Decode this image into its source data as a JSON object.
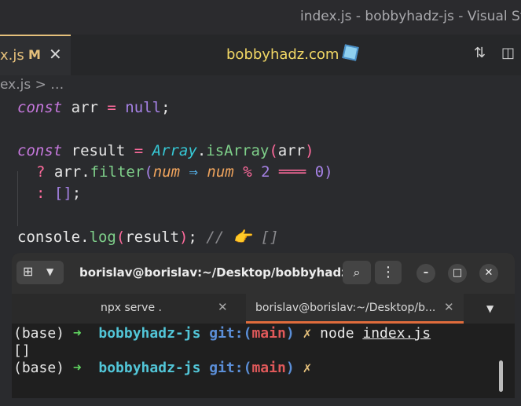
{
  "window": {
    "title": "index.js - bobbyhadz-js - Visual Stu"
  },
  "editor_tab": {
    "filename": "x.js",
    "modified_badge": "M",
    "close_glyph": "✕"
  },
  "center_title": "bobbyhadz.com",
  "breadcrumb": "ex.js > …",
  "code": {
    "line1": {
      "kw": "const",
      "name": " arr ",
      "op": "=",
      "val": " null",
      "semi": ";"
    },
    "line3": {
      "kw": "const",
      "name": " result ",
      "op": "=",
      "cls": " Array",
      "dot": ".",
      "fn": "isArray",
      "p1": "(",
      "arg": "arr",
      "p2": ")"
    },
    "line4": {
      "q": "? ",
      "obj": "arr",
      "dot": ".",
      "fn": "filter",
      "p1": "(",
      "param": "num",
      "arrow": " ⇒ ",
      "param2": "num",
      "mod": " % ",
      "two": "2",
      "eq": " ═══ ",
      "zero": "0",
      "p2": ")"
    },
    "line5": {
      "colon": ": ",
      "arr": "[]",
      "semi": ";"
    },
    "line7": {
      "obj": "console",
      "dot": ".",
      "fn": "log",
      "p1": "(",
      "arg": "result",
      "p2": ")",
      "semi": ";",
      "comment": " // 👉 []"
    }
  },
  "terminal": {
    "title": "borislav@borislav:~/Desktop/bobbyhadz-r...",
    "tabs": [
      {
        "label": "npx serve ."
      },
      {
        "label": "borislav@borislav:~/Desktop/b..."
      }
    ],
    "lines": [
      {
        "base": "(base) ",
        "arrow": "➜",
        "dir": "  bobbyhadz-js",
        "git": " git:(",
        "branch": "main",
        "gitclose": ")",
        "x": " ✗",
        "cmd": " node ",
        "file": "index.js"
      },
      {
        "output": "[]"
      },
      {
        "base": "(base) ",
        "arrow": "➜",
        "dir": "  bobbyhadz-js",
        "git": " git:(",
        "branch": "main",
        "gitclose": ")",
        "x": " ✗"
      }
    ]
  }
}
